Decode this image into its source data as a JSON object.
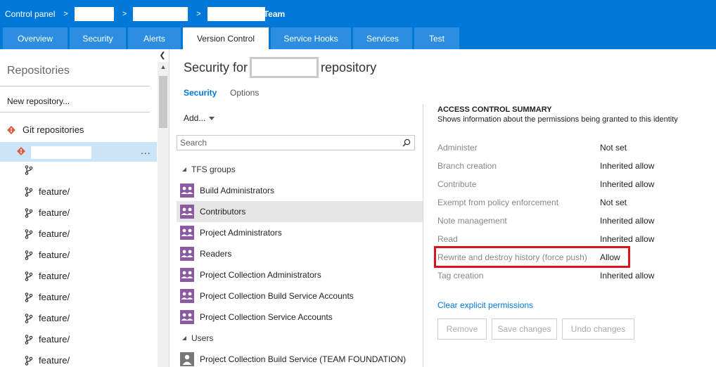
{
  "header": {
    "breadcrumb_root": "Control panel",
    "separator": ">",
    "team_suffix": "Team"
  },
  "tabs": [
    {
      "label": "Overview"
    },
    {
      "label": "Security"
    },
    {
      "label": "Alerts"
    },
    {
      "label": "Version Control",
      "active": true
    },
    {
      "label": "Service Hooks"
    },
    {
      "label": "Services"
    },
    {
      "label": "Test"
    }
  ],
  "sidebar": {
    "title": "Repositories",
    "new_repo": "New repository...",
    "git_repos": "Git repositories",
    "more": "...",
    "branches": [
      "",
      "feature/",
      "feature/",
      "feature/",
      "feature/",
      "feature/",
      "feature/",
      "feature/",
      "feature/",
      "feature/"
    ]
  },
  "main": {
    "title_prefix": "Security for",
    "title_suffix": "repository",
    "subtabs": [
      "Security",
      "Options"
    ],
    "add_label": "Add...",
    "search_placeholder": "Search",
    "groups": [
      {
        "header": "TFS groups",
        "items": [
          "Build Administrators",
          "Contributors",
          "Project Administrators",
          "Readers",
          "Project Collection Administrators",
          "Project Collection Build Service Accounts",
          "Project Collection Service Accounts"
        ]
      },
      {
        "header": "Users",
        "items": [
          "Project Collection Build Service (TEAM FOUNDATION)"
        ]
      }
    ]
  },
  "acs": {
    "title": "ACCESS CONTROL SUMMARY",
    "subtitle": "Shows information about the permissions being granted to this identity",
    "permissions": [
      {
        "name": "Administer",
        "value": "Not set"
      },
      {
        "name": "Branch creation",
        "value": "Inherited allow"
      },
      {
        "name": "Contribute",
        "value": "Inherited allow"
      },
      {
        "name": "Exempt from policy enforcement",
        "value": "Not set"
      },
      {
        "name": "Note management",
        "value": "Inherited allow"
      },
      {
        "name": "Read",
        "value": "Inherited allow"
      },
      {
        "name": "Rewrite and destroy history (force push)",
        "value": "Allow"
      },
      {
        "name": "Tag creation",
        "value": "Inherited allow"
      }
    ],
    "clear_link": "Clear explicit permissions",
    "buttons": {
      "remove": "Remove",
      "save": "Save changes",
      "undo": "Undo changes"
    }
  },
  "colors": {
    "accent": "#0078d7",
    "tab_bg": "#2b8ee0",
    "selected_row": "#cce4f7",
    "highlight": "#d8141c",
    "group_icon": "#8c5aa0",
    "git_icon": "#e05a3c"
  }
}
